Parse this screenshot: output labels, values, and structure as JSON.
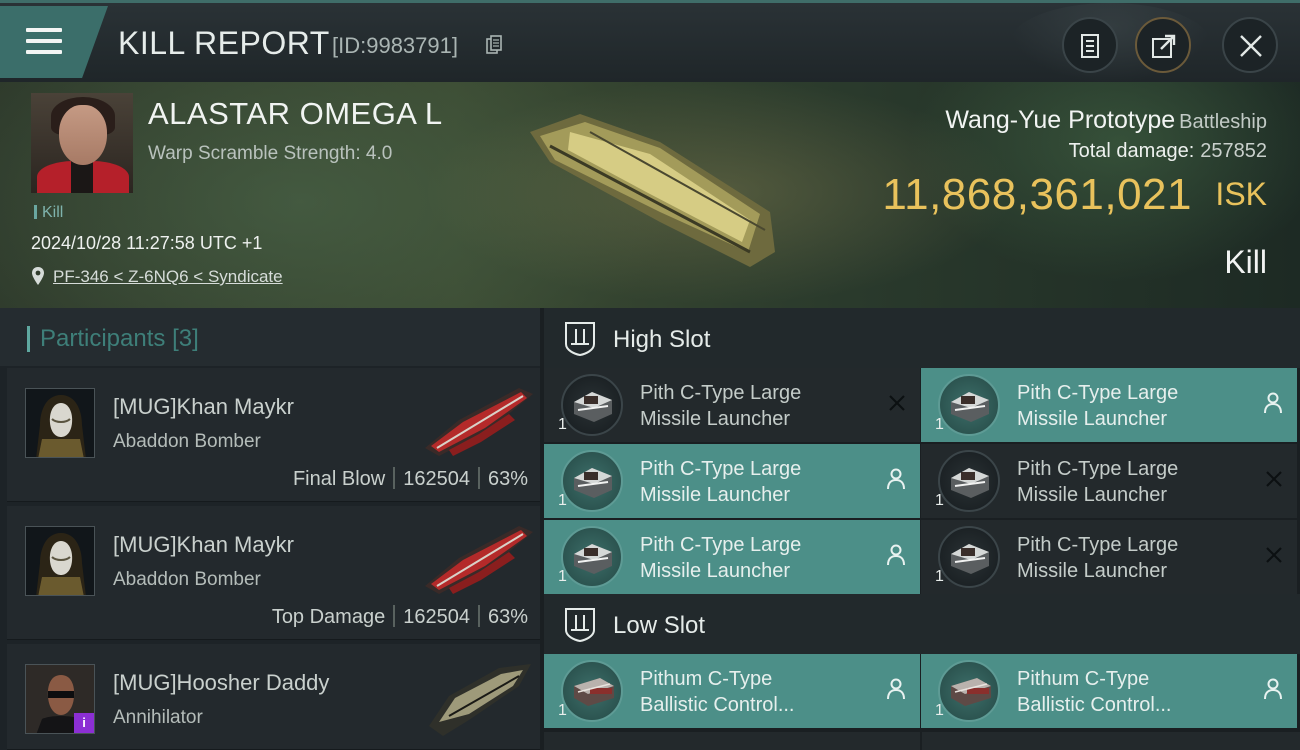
{
  "header": {
    "title": "KILL REPORT",
    "report_id": "[ID:9983791]"
  },
  "victim": {
    "name": "ALASTAR OMEGA L",
    "warp_scramble": "Warp Scramble Strength: 4.0",
    "kill_tag": "Kill",
    "timestamp": "2024/10/28 11:27:58 UTC +1",
    "location": "PF-346 < Z-6NQ6 < Syndicate",
    "ship_name": "Wang-Yue Prototype",
    "ship_class": "Battleship",
    "total_damage_label": "Total damage:",
    "total_damage": "257852",
    "isk_value": "11,868,361,021",
    "isk_unit": "ISK",
    "result": "Kill"
  },
  "participants": {
    "title": "Participants",
    "count": "[3]",
    "items": [
      {
        "name": "[MUG]Khan Maykr",
        "ship": "Abaddon Bomber",
        "role": "Final Blow",
        "damage": "162504",
        "percent": "63%"
      },
      {
        "name": "[MUG]Khan Maykr",
        "ship": "Abaddon Bomber",
        "role": "Top Damage",
        "damage": "162504",
        "percent": "63%"
      },
      {
        "name": "[MUG]Hoosher Daddy",
        "ship": "Annihilator"
      }
    ]
  },
  "slots": {
    "high": {
      "title": "High Slot",
      "modules": [
        {
          "line1": "Pith C-Type Large",
          "line2": "Missile Launcher",
          "qty": "1",
          "state": "destroyed"
        },
        {
          "line1": "Pith C-Type Large",
          "line2": "Missile Launcher",
          "qty": "1",
          "state": "dropped"
        },
        {
          "line1": "Pith C-Type Large",
          "line2": "Missile Launcher",
          "qty": "1",
          "state": "dropped"
        },
        {
          "line1": "Pith C-Type Large",
          "line2": "Missile Launcher",
          "qty": "1",
          "state": "destroyed"
        },
        {
          "line1": "Pith C-Type Large",
          "line2": "Missile Launcher",
          "qty": "1",
          "state": "dropped"
        },
        {
          "line1": "Pith C-Type Large",
          "line2": "Missile Launcher",
          "qty": "1",
          "state": "destroyed"
        }
      ]
    },
    "low": {
      "title": "Low Slot",
      "modules": [
        {
          "line1": "Pithum C-Type",
          "line2": "Ballistic Control...",
          "qty": "1",
          "state": "dropped"
        },
        {
          "line1": "Pithum C-Type",
          "line2": "Ballistic Control...",
          "qty": "1",
          "state": "dropped"
        }
      ]
    }
  },
  "colors": {
    "accent": "#4c8f88",
    "isk": "#e9c25c",
    "header": "#3b6e6a"
  },
  "icons": [
    "menu-icon",
    "copy-icon",
    "clipboard-icon",
    "share-icon",
    "close-icon",
    "location-pin-icon",
    "high-slot-icon",
    "low-slot-icon",
    "destroyed-x-icon",
    "dropped-person-icon"
  ]
}
